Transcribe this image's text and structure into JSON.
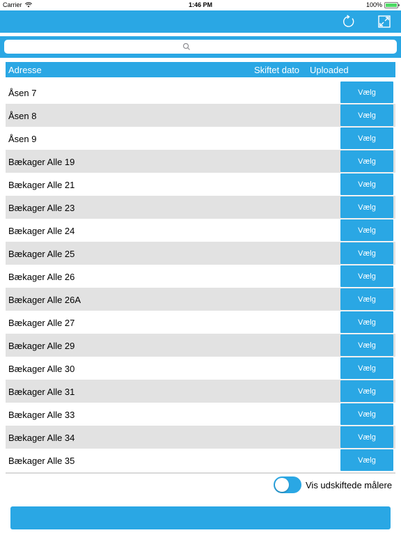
{
  "status": {
    "carrier": "Carrier",
    "time": "1:46 PM",
    "battery": "100%"
  },
  "navbar": {
    "refresh_icon": "refresh-icon",
    "expand_icon": "expand-icon"
  },
  "search": {
    "placeholder": "",
    "value": ""
  },
  "table": {
    "headers": {
      "address": "Adresse",
      "changed_date": "Skiftet dato",
      "uploaded": "Uploaded"
    },
    "button_label": "Vælg",
    "rows": [
      "Åsen 7",
      "Åsen 8",
      "Åsen 9",
      "Bækager Alle 19",
      "Bækager Alle 21",
      "Bækager Alle 23",
      "Bækager Alle 24",
      "Bækager Alle 25",
      "Bækager Alle 26",
      "Bækager Alle 26A",
      "Bækager Alle 27",
      "Bækager Alle 29",
      "Bækager Alle 30",
      "Bækager Alle 31",
      "Bækager Alle 33",
      "Bækager Alle 34",
      "Bækager Alle 35"
    ]
  },
  "toggle": {
    "label": "Vis udskiftede målere",
    "on": true
  },
  "bottom_button": {
    "label": ""
  },
  "colors": {
    "accent": "#2aa7e4",
    "row_alt": "#e2e2e2"
  }
}
